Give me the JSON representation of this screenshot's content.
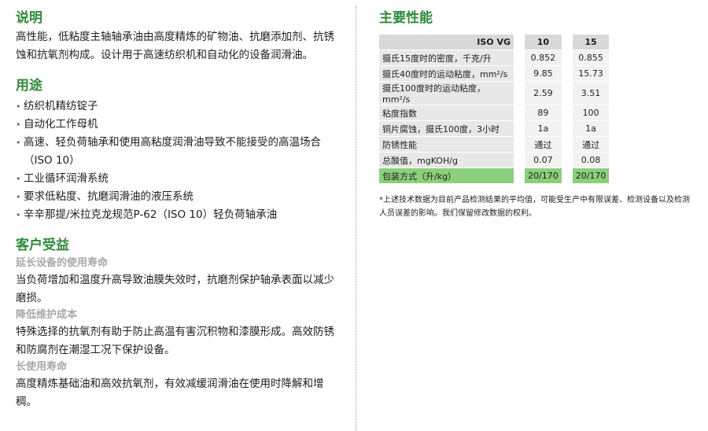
{
  "left": {
    "desc_title": "说明",
    "desc_text": "高性能，低粘度主轴轴承油由高度精炼的矿物油、抗磨添加剂、抗锈蚀和抗氧剂构成。设计用于高速纺织机和自动化的设备润滑油。",
    "use_title": "用途",
    "uses": [
      "纺织机精纺锭子",
      "自动化工作母机",
      "高速、轻负荷轴承和使用高粘度润滑油导致不能接受的高温场合（ISO 10）",
      "工业循环润滑系统",
      "要求低粘度、抗磨润滑油的液压系统",
      "辛辛那提/米拉克龙规范P-62（ISO 10）轻负荷轴承油"
    ],
    "benefit_title": "客户受益",
    "benefits": [
      {
        "head": "延长设备的使用寿命",
        "text": "当负荷增加和温度升高导致油膜失效时，抗磨剂保护轴承表面以减少磨损。"
      },
      {
        "head": "降低维护成本",
        "text": "特殊选择的抗氧剂有助于防止高温有害沉积物和漆膜形成。高效防锈和防腐剂在潮湿工况下保护设备。"
      },
      {
        "head": "长使用寿命",
        "text": "高度精炼基础油和高效抗氧剂，有效减缓润滑油在使用时降解和增稠。"
      }
    ]
  },
  "right": {
    "title": "主要性能",
    "table": {
      "header": [
        "ISO VG",
        "10",
        "15"
      ],
      "rows": [
        [
          "摄氏15度时的密度，千克/升",
          "0.852",
          "0.855"
        ],
        [
          "摄氏40度时的运动粘度，mm²/s",
          "9.85",
          "15.73"
        ],
        [
          "摄氏100度时的运动粘度，mm²/s",
          "2.59",
          "3.51"
        ],
        [
          "粘度指数",
          "89",
          "100"
        ],
        [
          "铜片腐蚀，摄氏100度，3小时",
          "1a",
          "1a"
        ],
        [
          "防锈性能",
          "通过",
          "通过"
        ],
        [
          "总酸值，mgKOH/g",
          "0.07",
          "0.08"
        ]
      ],
      "pack": [
        "包装方式（升/kg）",
        "20/170",
        "20/170"
      ]
    },
    "note": "*上述技术数据为目前产品检测结果的平均值，可能受生产中有限误差、检测设备以及检测人员误差的影响。我们保留修改数据的权利。"
  }
}
